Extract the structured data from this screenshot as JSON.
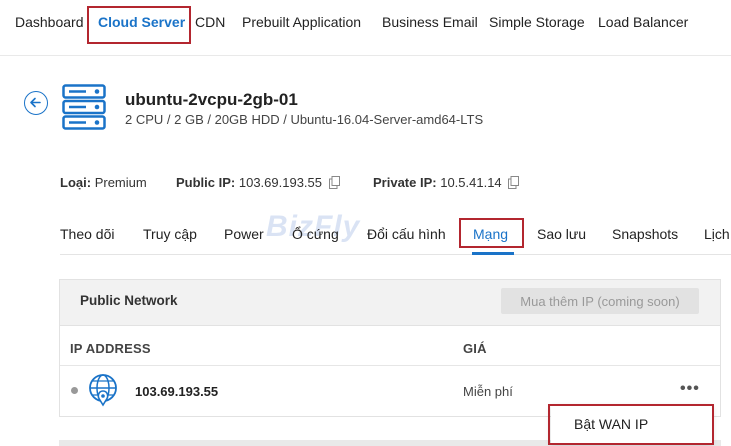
{
  "topnav": {
    "items": [
      {
        "label": "Dashboard"
      },
      {
        "label": "Cloud Server"
      },
      {
        "label": "CDN"
      },
      {
        "label": "Prebuilt Application"
      },
      {
        "label": "Business Email"
      },
      {
        "label": "Simple Storage"
      },
      {
        "label": "Load Balancer"
      }
    ],
    "active_index": 1
  },
  "server": {
    "name": "ubuntu-2vcpu-2gb-01",
    "spec": "2 CPU / 2 GB / 20GB HDD / Ubuntu-16.04-Server-amd64-LTS"
  },
  "info": {
    "type_label": "Loại:",
    "type_value": "Premium",
    "public_ip_label": "Public IP:",
    "public_ip_value": "103.69.193.55",
    "private_ip_label": "Private IP:",
    "private_ip_value": "10.5.41.14"
  },
  "tabs": [
    {
      "label": "Theo dõi"
    },
    {
      "label": "Truy cập"
    },
    {
      "label": "Power"
    },
    {
      "label": "Ổ cứng"
    },
    {
      "label": "Đổi cấu hình"
    },
    {
      "label": "Mạng"
    },
    {
      "label": "Sao lưu"
    },
    {
      "label": "Snapshots"
    },
    {
      "label": "Lịch"
    }
  ],
  "active_tab": "Mạng",
  "watermark": "BizFly",
  "panel": {
    "title": "Public Network",
    "buy_button": "Mua thêm IP (coming soon)",
    "columns": {
      "ip": "IP ADDRESS",
      "price": "GIÁ"
    },
    "rows": [
      {
        "ip": "103.69.193.55",
        "price": "Miễn phí",
        "more": "•••"
      }
    ]
  },
  "dropdown": {
    "item": "Bật WAN IP"
  },
  "colors": {
    "accent": "#1a73c8",
    "highlight_box": "#b3262f"
  }
}
